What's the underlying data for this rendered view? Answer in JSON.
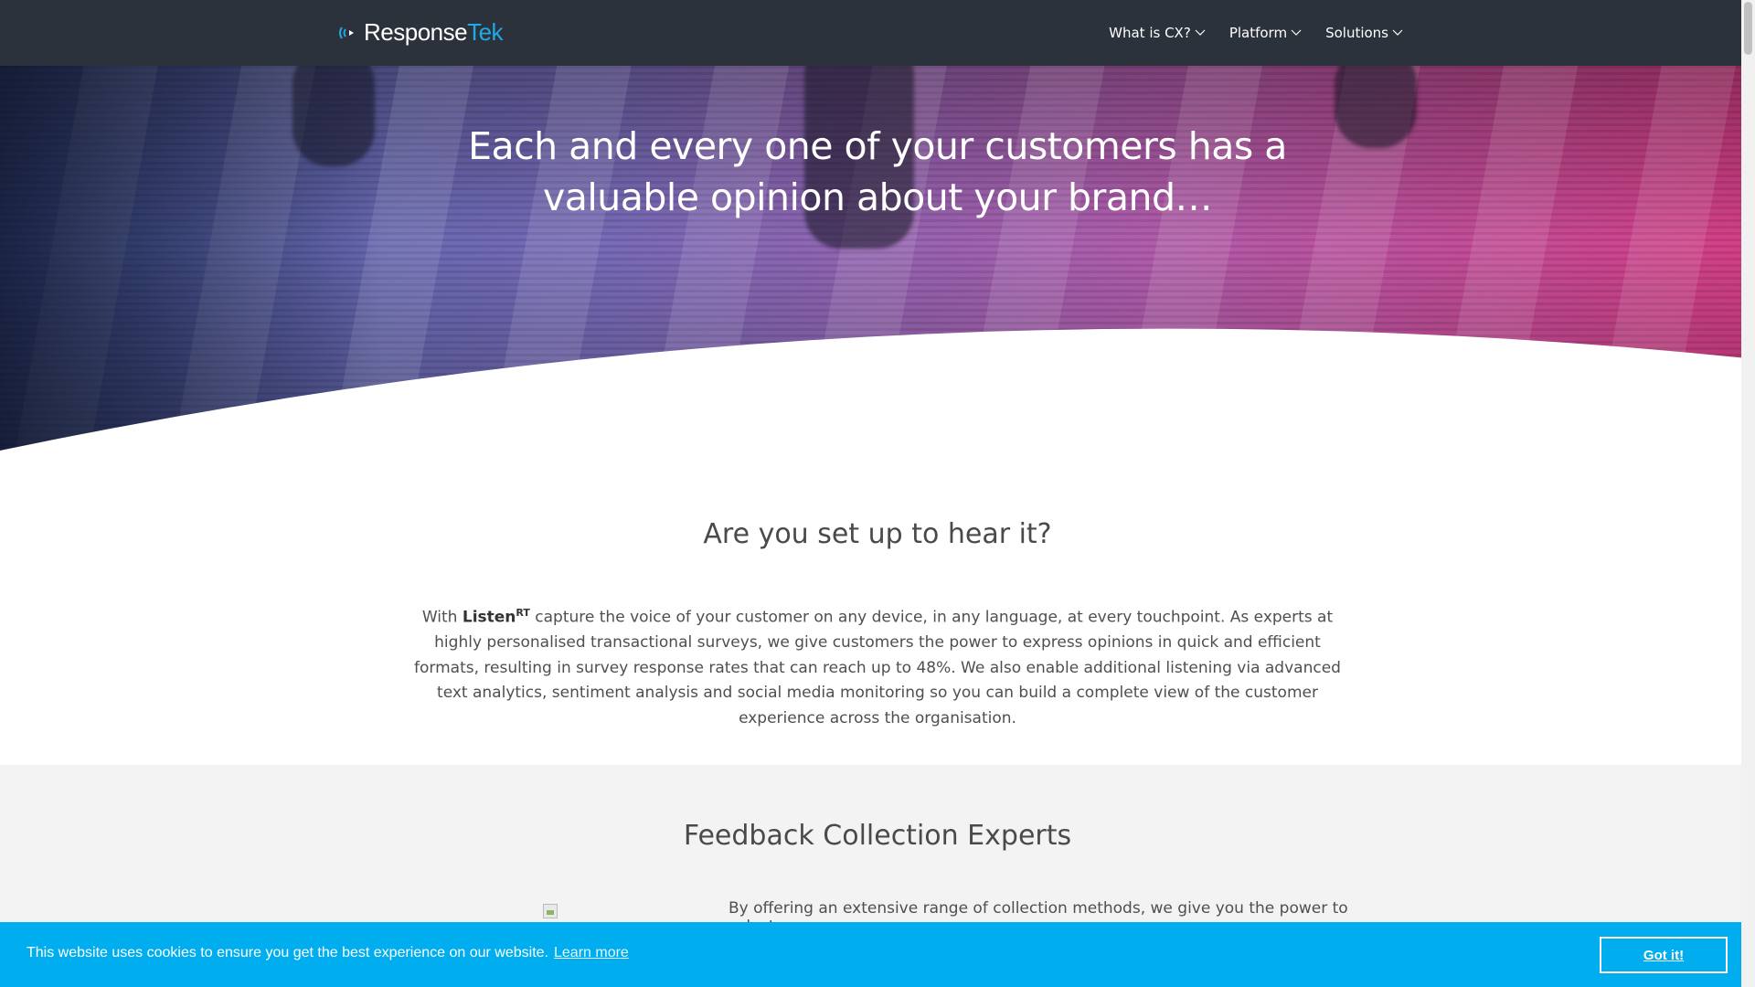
{
  "nav": {
    "logo_part1": "Response",
    "logo_part2": "Tek",
    "items": [
      {
        "label": "What is CX?"
      },
      {
        "label": "Platform"
      },
      {
        "label": "Solutions"
      }
    ]
  },
  "hero": {
    "headline": "Each and every one of your customers has a valuable opinion about your brand…"
  },
  "intro": {
    "heading": "Are you set up to hear it?",
    "body_prefix": "With ",
    "brand": "Listen",
    "brand_sup": "RT",
    "body": " capture the voice of your customer on any device, in any language, at every touchpoint. As experts at highly personalised transactional surveys, we give customers the power to express opinions in quick and efficient formats, resulting in survey response rates that can reach up to 48%. We also enable additional listening via advanced text analytics, sentiment analysis and social media monitoring so you can build a complete view of the customer experience across the organisation."
  },
  "feedback": {
    "heading": "Feedback Collection Experts",
    "text": "By offering an extensive range of collection methods, we give you the power to select"
  },
  "cookie": {
    "message": "This website uses cookies to ensure you get the best experience on our website.",
    "learn_more": "Learn more",
    "button": "Got it!"
  },
  "colors": {
    "nav_bg": "#2c323b",
    "brand_accent": "#20a9e6",
    "cookie_bg": "#00aeef",
    "section_alt_bg": "#f3f3f3"
  }
}
